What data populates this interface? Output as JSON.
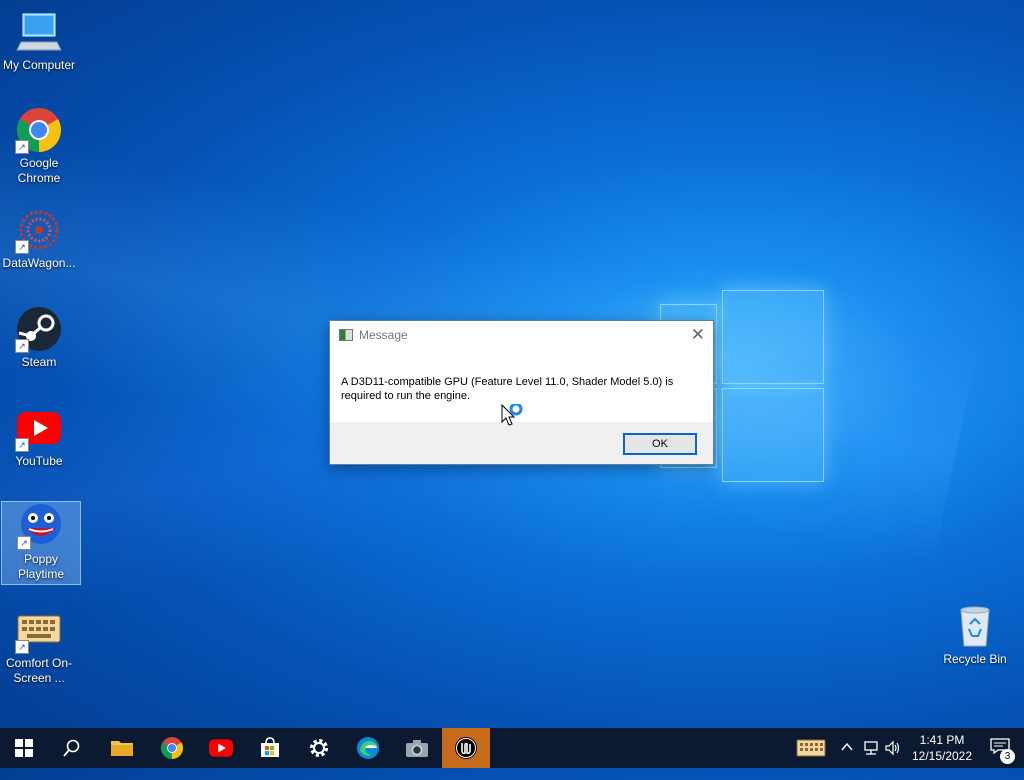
{
  "desktop_icons": [
    {
      "label": "My Computer"
    },
    {
      "label": "Google Chrome"
    },
    {
      "label": "DataWagon..."
    },
    {
      "label": "Steam"
    },
    {
      "label": "YouTube"
    },
    {
      "label": "Poppy Playtime"
    },
    {
      "label": "Comfort On-Screen ..."
    },
    {
      "label": "Recycle Bin"
    }
  ],
  "dialog": {
    "title": "Message",
    "message": "A D3D11-compatible GPU (Feature Level 11.0, Shader Model 5.0) is required to run the engine.",
    "ok_label": "OK",
    "close_glyph": "✕"
  },
  "taskbar": {
    "apps": [
      "start",
      "search",
      "file-explorer",
      "chrome",
      "youtube",
      "store",
      "settings",
      "edge",
      "camera",
      "unreal-engine"
    ],
    "active_app": "unreal-engine",
    "time": "1:41 PM",
    "date": "12/15/2022",
    "notification_count": "3"
  },
  "colors": {
    "taskbar": "#0b1a30",
    "active_task": "#c66b1c",
    "ok_border": "#0a64c8"
  }
}
